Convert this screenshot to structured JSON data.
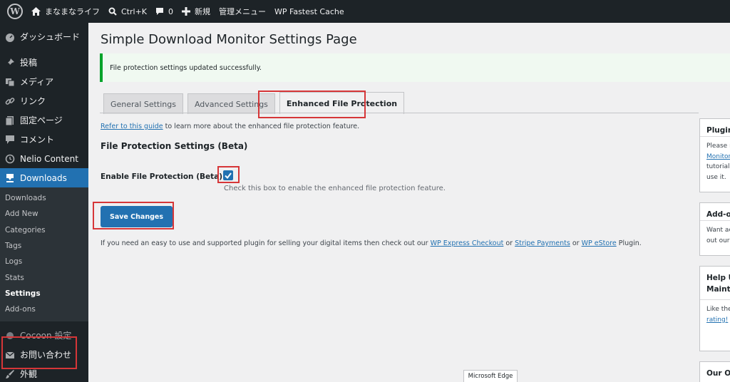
{
  "adminbar": {
    "site_name": "まなまなライフ",
    "search_shortcut": "Ctrl+K",
    "comments_count": "0",
    "new_label": "新規",
    "admin_menu_label": "管理メニュー",
    "cache_label": "WP Fastest Cache"
  },
  "sidebar": {
    "dashboard": "ダッシュボード",
    "posts": "投稿",
    "media": "メディア",
    "links": "リンク",
    "pages": "固定ページ",
    "comments": "コメント",
    "nelio": "Nelio Content",
    "downloads": "Downloads",
    "submenu": [
      "Downloads",
      "Add New",
      "Categories",
      "Tags",
      "Logs",
      "Stats",
      "Settings",
      "Add-ons"
    ],
    "cocoon": "Cocoon 設定",
    "contact": "お問い合わせ",
    "appearance": "外観"
  },
  "page": {
    "title": "Simple Download Monitor Settings Page",
    "notice": "File protection settings updated successfully.",
    "tabs": [
      "General Settings",
      "Advanced Settings",
      "Enhanced File Protection"
    ],
    "guide_link": "Refer to this guide",
    "guide_text": " to learn more about the enhanced file protection feature.",
    "section_title": "File Protection Settings (Beta)",
    "field_label": "Enable File Protection (Beta)",
    "field_desc": "Check this box to enable the enhanced file protection feature.",
    "save_label": "Save Changes",
    "promo_text_1": "If you need an easy to use and supported plugin for selling your digital items then check out our ",
    "promo_link_1": "WP Express Checkout",
    "promo_or_1": " or ",
    "promo_link_2": "Stripe Payments",
    "promo_or_2": " or ",
    "promo_link_3": "WP eStore",
    "promo_text_2": " Plugin."
  },
  "side_boxes": {
    "box1_title": "Plugin",
    "box1_line1": "Please r",
    "box1_link": "Monitor",
    "box1_line3": "tutorial",
    "box1_line4": "use it.",
    "box2_title": "Add-o",
    "box2_line1": "Want ac",
    "box2_line2": "out our",
    "box3_title1": "Help U",
    "box3_title2": "Mainta",
    "box3_line1": "Like the",
    "box3_link": "rating!",
    "box4_title": "Our Ot"
  },
  "tooltip": "Microsoft Edge",
  "colors": {
    "admin_dark": "#1d2327",
    "accent_blue": "#2271b1",
    "highlight_red": "#d63638",
    "success_green": "#00a32a"
  }
}
